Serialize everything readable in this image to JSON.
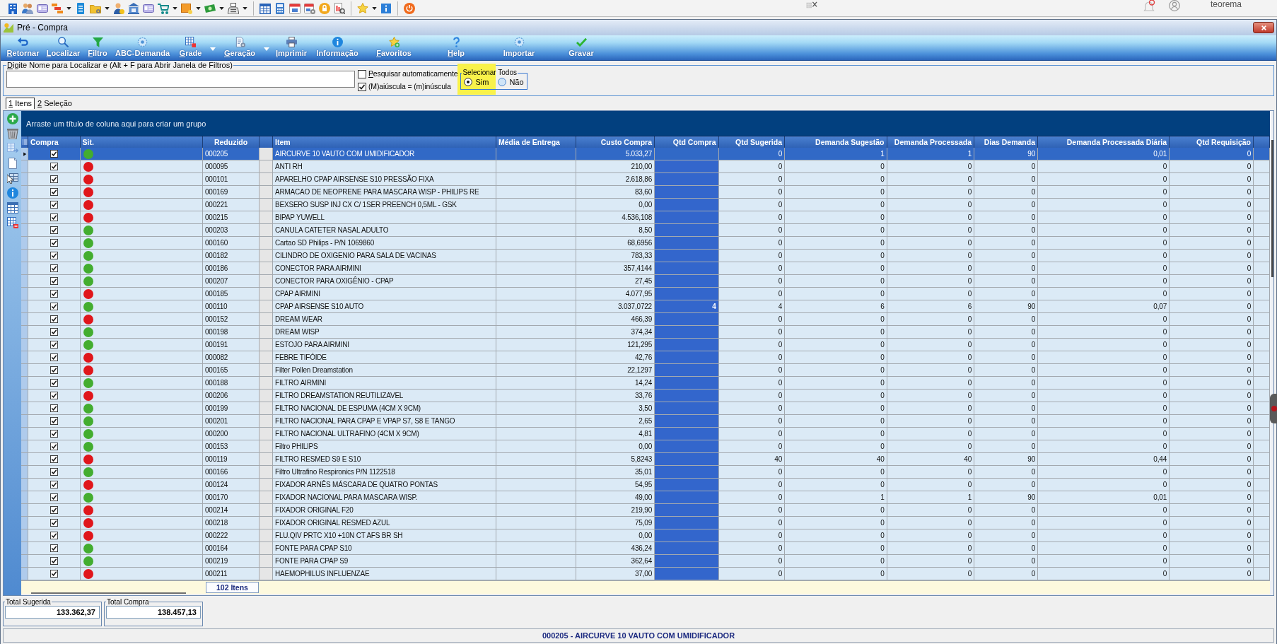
{
  "taskbar": {
    "user_name": "teorema"
  },
  "window": {
    "title": "Pré - Compra"
  },
  "ribbon": [
    {
      "label": "Retornar",
      "mnemonic": true,
      "dropdown": false
    },
    {
      "label": "Localizar",
      "mnemonic": true,
      "dropdown": false
    },
    {
      "label": "Filtro",
      "mnemonic": true,
      "dropdown": false
    },
    {
      "label": "ABC-Demanda",
      "mnemonic": false,
      "dropdown": false
    },
    {
      "label": "Grade",
      "mnemonic": true,
      "dropdown": true
    },
    {
      "label": "Geração",
      "mnemonic": true,
      "dropdown": true
    },
    {
      "label": "Imprimir",
      "mnemonic": true,
      "dropdown": false
    },
    {
      "label": "Informação",
      "mnemonic": false,
      "dropdown": false
    },
    {
      "label": "Favoritos",
      "mnemonic": true,
      "dropdown": false
    },
    {
      "label": "Help",
      "mnemonic": true,
      "dropdown": false
    },
    {
      "label": "Importar",
      "mnemonic": false,
      "dropdown": false
    },
    {
      "label": "Gravar",
      "mnemonic": false,
      "dropdown": false
    }
  ],
  "search": {
    "legend": "Digite Nome para Localizar e (Alt + F para Abrir Janela de Filtros)",
    "mnemonic": true
  },
  "options": [
    {
      "label": "Pesquisar automaticamente",
      "checked": false,
      "mnemonic": true
    },
    {
      "label": "(M)aiúscula = (m)inúscula",
      "checked": true
    }
  ],
  "select_all": {
    "legend": "Selecionar Todos",
    "highlighted": true,
    "options": [
      {
        "label": "Sim",
        "selected": true
      },
      {
        "label": "Não",
        "selected": false
      }
    ]
  },
  "tabs": [
    {
      "label": "1 Itens",
      "selected": true,
      "mnemonic": true
    },
    {
      "label": "2 Seleção",
      "selected": false,
      "mnemonic": true
    }
  ],
  "grid": {
    "group_hint": "Arraste um título de coluna aqui para criar um grupo",
    "columns": [
      "Compra",
      "Sit.",
      "Reduzido",
      "Item",
      "Média de Entrega",
      "Custo Compra",
      "Qtd Compra",
      "Qtd Sugerida",
      "Demanda Sugestão",
      "Demanda Processada",
      "Dias Demanda",
      "Demanda Processada Diária",
      "Qtd Requisição"
    ],
    "rows": [
      {
        "selected": true,
        "checked": true,
        "color": "#43ad2f",
        "reduzido": "000205",
        "item": "AIRCURVE 10 VAUTO COM UMIDIFICADOR",
        "custo_compra": "5.033,27",
        "values": [
          "0",
          "1",
          "1",
          "90",
          "0,01",
          "0"
        ]
      },
      {
        "selected": false,
        "checked": true,
        "color": "#e0161b",
        "reduzido": "000095",
        "item": "ANTI RH",
        "custo_compra": "210,00",
        "values": [
          "0",
          "0",
          "0",
          "0",
          "0",
          "0"
        ]
      },
      {
        "selected": false,
        "checked": true,
        "color": "#e0161b",
        "reduzido": "000101",
        "item": "APARELHO CPAP AIRSENSE S10 PRESSÃO FIXA",
        "custo_compra": "2.618,86",
        "values": [
          "0",
          "0",
          "0",
          "0",
          "0",
          "0"
        ]
      },
      {
        "selected": false,
        "checked": true,
        "color": "#e0161b",
        "reduzido": "000169",
        "item": "ARMACAO DE NEOPRENE PARA MASCARA WISP - PHILIPS RE",
        "custo_compra": "83,60",
        "values": [
          "0",
          "0",
          "0",
          "0",
          "0",
          "0"
        ]
      },
      {
        "selected": false,
        "checked": true,
        "color": "#e0161b",
        "reduzido": "000221",
        "item": "BEXSERO SUSP INJ CX C/ 1SER PREENCH 0,5ML - GSK",
        "custo_compra": "0,00",
        "values": [
          "0",
          "0",
          "0",
          "0",
          "0",
          "0"
        ]
      },
      {
        "selected": false,
        "checked": true,
        "color": "#e0161b",
        "reduzido": "000215",
        "item": "BIPAP YUWELL",
        "custo_compra": "4.536,108",
        "values": [
          "0",
          "0",
          "0",
          "0",
          "0",
          "0"
        ]
      },
      {
        "selected": false,
        "checked": true,
        "color": "#43ad2f",
        "reduzido": "000203",
        "item": "CANULA CATETER NASAL ADULTO",
        "custo_compra": "8,50",
        "values": [
          "0",
          "0",
          "0",
          "0",
          "0",
          "0"
        ]
      },
      {
        "selected": false,
        "checked": true,
        "color": "#43ad2f",
        "reduzido": "000160",
        "item": "Cartao SD Philips - P/N 1069860",
        "custo_compra": "68,6956",
        "values": [
          "0",
          "0",
          "0",
          "0",
          "0",
          "0"
        ]
      },
      {
        "selected": false,
        "checked": true,
        "color": "#43ad2f",
        "reduzido": "000182",
        "item": "CILINDRO DE OXIGENIO PARA SALA DE VACINAS",
        "custo_compra": "783,33",
        "values": [
          "0",
          "0",
          "0",
          "0",
          "0",
          "0"
        ]
      },
      {
        "selected": false,
        "checked": true,
        "color": "#43ad2f",
        "reduzido": "000186",
        "item": "CONECTOR PARA AIRMINI",
        "custo_compra": "357,4144",
        "values": [
          "0",
          "0",
          "0",
          "0",
          "0",
          "0"
        ]
      },
      {
        "selected": false,
        "checked": true,
        "color": "#43ad2f",
        "reduzido": "000207",
        "item": "CONECTOR PARA OXIGÊNIO - CPAP",
        "custo_compra": "27,45",
        "values": [
          "0",
          "0",
          "0",
          "0",
          "0",
          "0"
        ]
      },
      {
        "selected": false,
        "checked": true,
        "color": "#e0161b",
        "reduzido": "000185",
        "item": "CPAP AIRMINI",
        "custo_compra": "4.077,95",
        "values": [
          "0",
          "0",
          "0",
          "0",
          "0",
          "0"
        ]
      },
      {
        "selected": false,
        "checked": true,
        "color": "#43ad2f",
        "reduzido": "000110",
        "item": "CPAP AIRSENSE S10 AUTO",
        "custo_compra": "3.037,0722",
        "qtd_compra": "4",
        "values": [
          "4",
          "6",
          "6",
          "90",
          "0,07",
          "0"
        ]
      },
      {
        "selected": false,
        "checked": true,
        "color": "#e0161b",
        "reduzido": "000152",
        "item": "DREAM WEAR",
        "custo_compra": "466,39",
        "values": [
          "0",
          "0",
          "0",
          "0",
          "0",
          "0"
        ]
      },
      {
        "selected": false,
        "checked": true,
        "color": "#43ad2f",
        "reduzido": "000198",
        "item": "DREAM WISP",
        "custo_compra": "374,34",
        "values": [
          "0",
          "0",
          "0",
          "0",
          "0",
          "0"
        ]
      },
      {
        "selected": false,
        "checked": true,
        "color": "#43ad2f",
        "reduzido": "000191",
        "item": "ESTOJO PARA AIRMINI",
        "custo_compra": "121,295",
        "values": [
          "0",
          "0",
          "0",
          "0",
          "0",
          "0"
        ]
      },
      {
        "selected": false,
        "checked": true,
        "color": "#e0161b",
        "reduzido": "000082",
        "item": "FEBRE TIFÓIDE",
        "custo_compra": "42,76",
        "values": [
          "0",
          "0",
          "0",
          "0",
          "0",
          "0"
        ]
      },
      {
        "selected": false,
        "checked": true,
        "color": "#e0161b",
        "reduzido": "000165",
        "item": "Filter Pollen Dreamstation",
        "custo_compra": "22,1297",
        "values": [
          "0",
          "0",
          "0",
          "0",
          "0",
          "0"
        ]
      },
      {
        "selected": false,
        "checked": true,
        "color": "#43ad2f",
        "reduzido": "000188",
        "item": "FILTRO AIRMINI",
        "custo_compra": "14,24",
        "values": [
          "0",
          "0",
          "0",
          "0",
          "0",
          "0"
        ]
      },
      {
        "selected": false,
        "checked": true,
        "color": "#e0161b",
        "reduzido": "000206",
        "item": "FILTRO DREAMSTATION REUTILIZAVEL",
        "custo_compra": "33,76",
        "values": [
          "0",
          "0",
          "0",
          "0",
          "0",
          "0"
        ]
      },
      {
        "selected": false,
        "checked": true,
        "color": "#43ad2f",
        "reduzido": "000199",
        "item": "FILTRO NACIONAL DE ESPUMA (4CM X 9CM)",
        "custo_compra": "3,50",
        "values": [
          "0",
          "0",
          "0",
          "0",
          "0",
          "0"
        ]
      },
      {
        "selected": false,
        "checked": true,
        "color": "#43ad2f",
        "reduzido": "000201",
        "item": "FILTRO NACIONAL PARA CPAP E VPAP S7, S8 E TANGO",
        "custo_compra": "2,65",
        "values": [
          "0",
          "0",
          "0",
          "0",
          "0",
          "0"
        ]
      },
      {
        "selected": false,
        "checked": true,
        "color": "#43ad2f",
        "reduzido": "000200",
        "item": "FILTRO NACIONAL ULTRAFINO (4CM X 9CM)",
        "custo_compra": "4,81",
        "values": [
          "0",
          "0",
          "0",
          "0",
          "0",
          "0"
        ]
      },
      {
        "selected": false,
        "checked": true,
        "color": "#43ad2f",
        "reduzido": "000153",
        "item": "Filtro PHILIPS",
        "custo_compra": "0,00",
        "values": [
          "0",
          "0",
          "0",
          "0",
          "0",
          "0"
        ]
      },
      {
        "selected": false,
        "checked": true,
        "color": "#e0161b",
        "reduzido": "000119",
        "item": "FILTRO RESMED S9 E S10",
        "custo_compra": "5,8243",
        "values": [
          "40",
          "40",
          "40",
          "90",
          "0,44",
          "0"
        ]
      },
      {
        "selected": false,
        "checked": true,
        "color": "#43ad2f",
        "reduzido": "000166",
        "item": "Filtro Ultrafino Respironics P/N 1122518",
        "custo_compra": "35,01",
        "values": [
          "0",
          "0",
          "0",
          "0",
          "0",
          "0"
        ]
      },
      {
        "selected": false,
        "checked": true,
        "color": "#e0161b",
        "reduzido": "000124",
        "item": "FIXADOR ARNÊS MÁSCARA DE QUATRO PONTAS",
        "custo_compra": "54,95",
        "values": [
          "0",
          "0",
          "0",
          "0",
          "0",
          "0"
        ]
      },
      {
        "selected": false,
        "checked": true,
        "color": "#43ad2f",
        "reduzido": "000170",
        "item": "FIXADOR NACIONAL PARA MASCARA WISP.",
        "custo_compra": "49,00",
        "values": [
          "0",
          "1",
          "1",
          "90",
          "0,01",
          "0"
        ]
      },
      {
        "selected": false,
        "checked": true,
        "color": "#e0161b",
        "reduzido": "000214",
        "item": "FIXADOR ORIGINAL F20",
        "custo_compra": "219,90",
        "values": [
          "0",
          "0",
          "0",
          "0",
          "0",
          "0"
        ]
      },
      {
        "selected": false,
        "checked": true,
        "color": "#e0161b",
        "reduzido": "000218",
        "item": "FIXADOR ORIGINAL RESMED AZUL",
        "custo_compra": "75,09",
        "values": [
          "0",
          "0",
          "0",
          "0",
          "0",
          "0"
        ]
      },
      {
        "selected": false,
        "checked": true,
        "color": "#e0161b",
        "reduzido": "000222",
        "item": "FLU.QIV PRTC X10 +10N CT AFS BR SH",
        "custo_compra": "0,00",
        "values": [
          "0",
          "0",
          "0",
          "0",
          "0",
          "0"
        ]
      },
      {
        "selected": false,
        "checked": true,
        "color": "#43ad2f",
        "reduzido": "000164",
        "item": "FONTE PARA CPAP S10",
        "custo_compra": "436,24",
        "values": [
          "0",
          "0",
          "0",
          "0",
          "0",
          "0"
        ]
      },
      {
        "selected": false,
        "checked": true,
        "color": "#43ad2f",
        "reduzido": "000219",
        "item": "FONTE PARA CPAP S9",
        "custo_compra": "362,64",
        "values": [
          "0",
          "0",
          "0",
          "0",
          "0",
          "0"
        ]
      },
      {
        "selected": false,
        "checked": true,
        "color": "#e0161b",
        "reduzido": "000211",
        "item": "HAEMOPHILUS INFLUENZAE",
        "custo_compra": "37,00",
        "values": [
          "0",
          "0",
          "0",
          "0",
          "0",
          "0"
        ]
      }
    ],
    "footer": "102 Itens"
  },
  "totals": [
    {
      "label": "Total Sugerida",
      "value": "133.362,37"
    },
    {
      "label": "Total Compra",
      "value": "138.457,13"
    }
  ],
  "status_bar": "000205 - AIRCURVE 10 VAUTO COM UMIDIFICADOR"
}
